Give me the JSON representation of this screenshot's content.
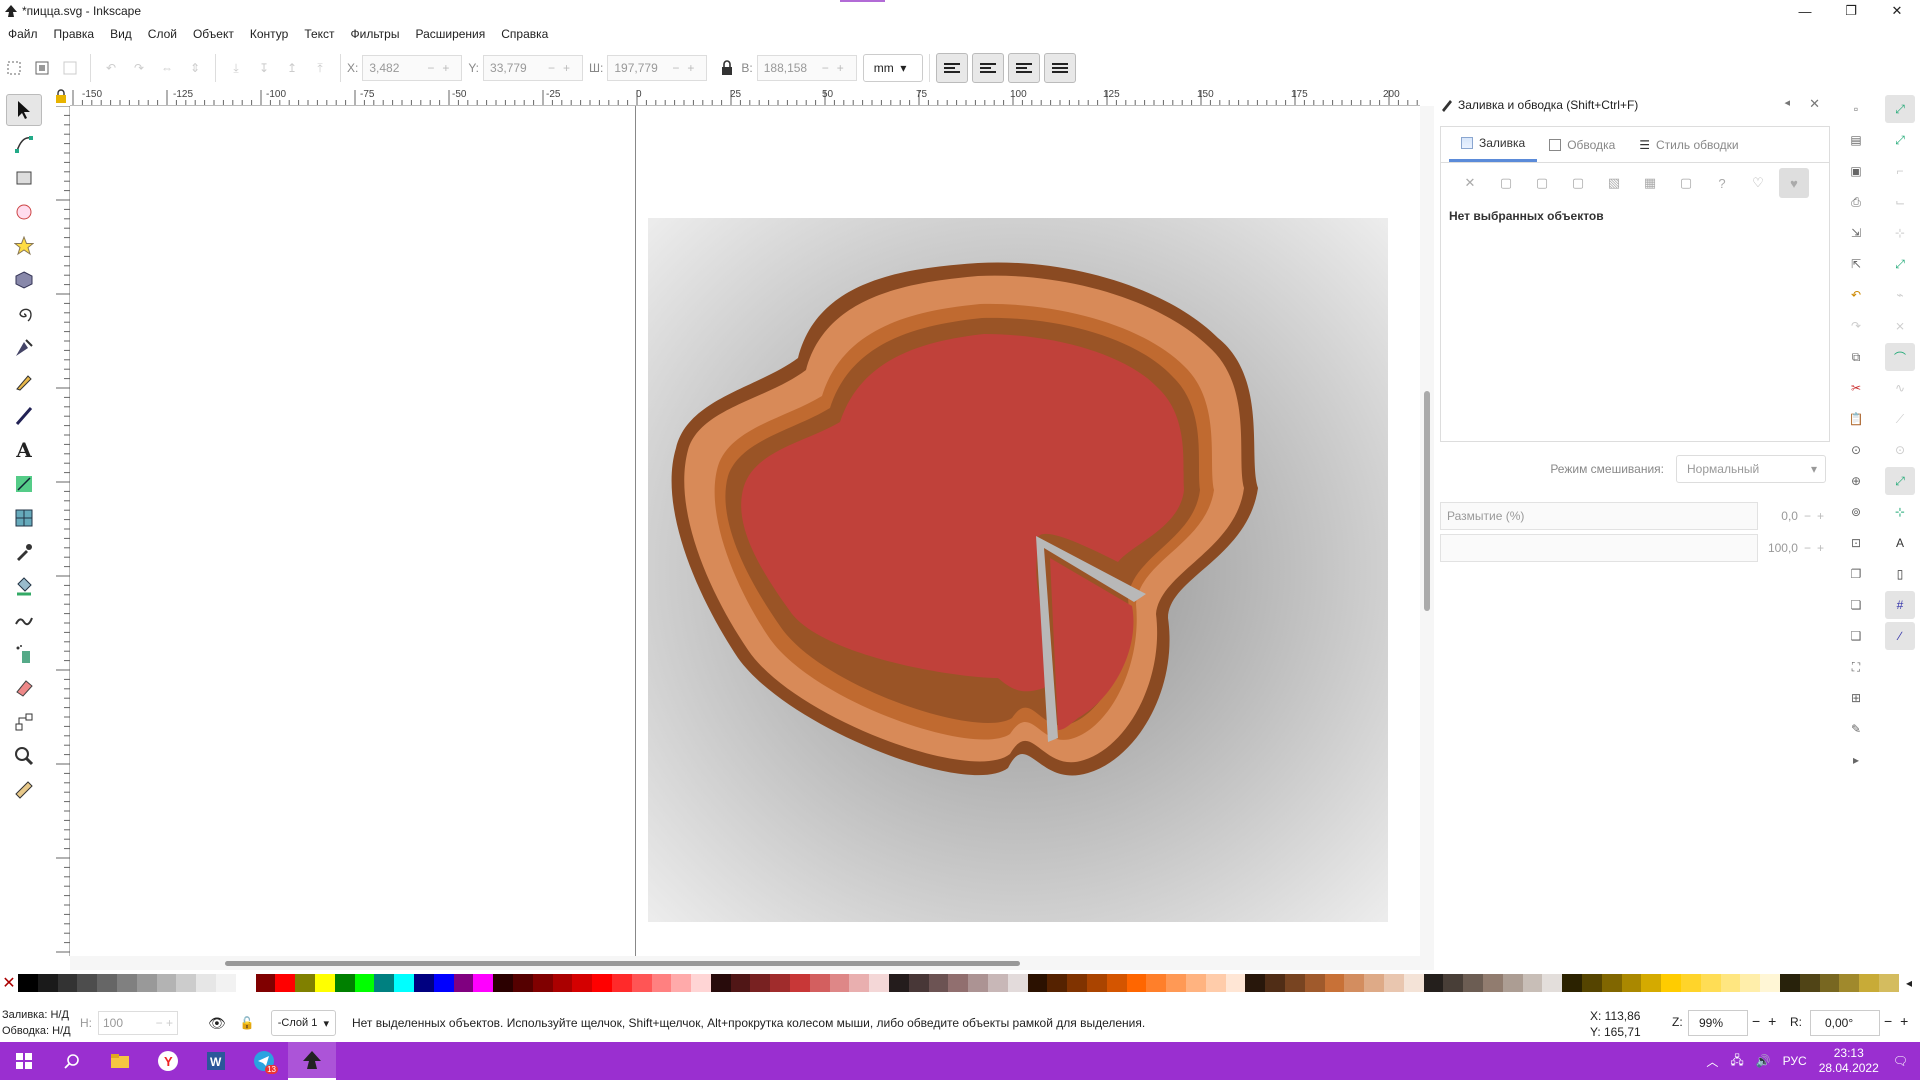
{
  "window": {
    "title": "*пицца.svg - Inkscape",
    "minimize": "—",
    "maximize": "❐",
    "close": "✕"
  },
  "menu": [
    "Файл",
    "Правка",
    "Вид",
    "Слой",
    "Объект",
    "Контур",
    "Текст",
    "Фильтры",
    "Расширения",
    "Справка"
  ],
  "toolbar": {
    "x_label": "X:",
    "x_value": "3,482",
    "y_label": "Y:",
    "y_value": "33,779",
    "w_label": "Ш:",
    "w_value": "197,779",
    "h_label": "В:",
    "h_value": "188,158",
    "unit": "mm"
  },
  "ruler": {
    "labels": [
      "-150",
      "-125",
      "-100",
      "-75",
      "-50",
      "-25",
      "0",
      "25",
      "50",
      "75",
      "100",
      "125",
      "150",
      "175",
      "200"
    ]
  },
  "fill_stroke_panel": {
    "title": "Заливка и обводка (Shift+Ctrl+F)",
    "tabs": [
      "Заливка",
      "Обводка",
      "Стиль обводки"
    ],
    "no_selection": "Нет выбранных объектов",
    "blend_label": "Режим смешивания:",
    "blend_value": "Нормальный",
    "blur_label": "Размытие (%)",
    "blur_value": "0,0",
    "opacity_value": "100,0"
  },
  "status": {
    "fill_label": "Заливка:",
    "fill_value": "Н/Д",
    "stroke_label": "Обводка:",
    "stroke_value": "Н/Д",
    "opacity_label": "Н:",
    "opacity_value": "100",
    "layer": "-Слой 1",
    "message": "Нет выделенных объектов. Используйте щелчок, Shift+щелчок, Alt+прокрутка колесом мыши, либо обведите объекты рамкой для выделения.",
    "cursor_x": "X:   113,86",
    "cursor_y": "Y:   165,71",
    "zoom_label": "Z:",
    "zoom": "99%",
    "rotation_label": "R:",
    "rotation": "0,00°"
  },
  "taskbar": {
    "lang": "РУС",
    "time": "23:13",
    "date": "28.04.2022",
    "telegram_badge": "13"
  },
  "colors": {
    "taskbar": "#9a2fd0",
    "sauce": "#c0413a",
    "crust_dark": "#8a4a22",
    "crust_mid": "#c06a30",
    "crust_light": "#d88a58"
  },
  "palette": [
    "#000000",
    "#1a1a1a",
    "#333333",
    "#4d4d4d",
    "#666666",
    "#808080",
    "#999999",
    "#b3b3b3",
    "#cccccc",
    "#e6e6e6",
    "#f2f2f2",
    "#ffffff",
    "#800000",
    "#ff0000",
    "#808000",
    "#ffff00",
    "#008000",
    "#00ff00",
    "#008080",
    "#00ffff",
    "#000080",
    "#0000ff",
    "#800080",
    "#ff00ff",
    "#2b0000",
    "#550000",
    "#800000",
    "#aa0000",
    "#d40000",
    "#ff0000",
    "#ff2a2a",
    "#ff5555",
    "#ff8080",
    "#ffaaaa",
    "#ffd5d5",
    "#280b0b",
    "#501616",
    "#782121",
    "#a02c2c",
    "#c83737",
    "#d35f5f",
    "#de8787",
    "#e9afaf",
    "#f4d7d7",
    "#241c1c",
    "#483737",
    "#6c5353",
    "#916f6f",
    "#ac9393",
    "#c8b7b7",
    "#e3dbdb",
    "#2b1100",
    "#552200",
    "#803300",
    "#aa4400",
    "#d45500",
    "#ff6600",
    "#ff7f2a",
    "#ff9955",
    "#ffb380",
    "#ffccaa",
    "#ffe6d5",
    "#28170b",
    "#502d16",
    "#784421",
    "#a05a2c",
    "#c87137",
    "#d38d5f",
    "#deaa87",
    "#e9c6af",
    "#f4e3d7",
    "#241f1c",
    "#483e37",
    "#6c5d53",
    "#917c6f",
    "#ac9d93",
    "#c8beb7",
    "#e3dedb",
    "#2b2200",
    "#554400",
    "#806600",
    "#aa8800",
    "#d4aa00",
    "#ffcc00",
    "#ffd42a",
    "#ffdd55",
    "#ffe680",
    "#ffeeaa",
    "#fff6d5",
    "#28220b",
    "#504416",
    "#786721",
    "#a0892c",
    "#c8ab37",
    "#d4bc5f"
  ]
}
